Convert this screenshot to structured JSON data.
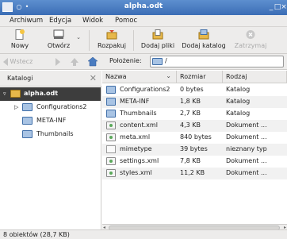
{
  "window": {
    "title": "alpha.odt"
  },
  "menu": [
    {
      "label": "Archiwum"
    },
    {
      "label": "Edycja"
    },
    {
      "label": "Widok"
    },
    {
      "label": "Pomoc"
    }
  ],
  "toolbar": {
    "new": "Nowy",
    "open": "Otwórz",
    "extract": "Rozpakuj",
    "add_files": "Dodaj pliki",
    "add_folder": "Dodaj katalog",
    "stop": "Zatrzymaj"
  },
  "location": {
    "back": "Wstecz",
    "label": "Położenie:",
    "path": "/"
  },
  "sidebar": {
    "title": "Katalogi",
    "root": "alpha.odt",
    "items": [
      "Configurations2",
      "META-INF",
      "Thumbnails"
    ]
  },
  "columns": {
    "name": "Nazwa",
    "size": "Rozmiar",
    "type": "Rodzaj"
  },
  "files": [
    {
      "name": "Configurations2",
      "size": "0 bytes",
      "type": "Katalog",
      "icon": "folder-icon"
    },
    {
      "name": "META-INF",
      "size": "1,8 KB",
      "type": "Katalog",
      "icon": "folder-icon"
    },
    {
      "name": "Thumbnails",
      "size": "2,7 KB",
      "type": "Katalog",
      "icon": "folder-icon"
    },
    {
      "name": "content.xml",
      "size": "4,3 KB",
      "type": "Dokument ...",
      "icon": "xml-file-icon"
    },
    {
      "name": "meta.xml",
      "size": "840 bytes",
      "type": "Dokument ...",
      "icon": "xml-file-icon"
    },
    {
      "name": "mimetype",
      "size": "39 bytes",
      "type": "nieznany typ",
      "icon": "file-icon"
    },
    {
      "name": "settings.xml",
      "size": "7,8 KB",
      "type": "Dokument ...",
      "icon": "xml-file-icon"
    },
    {
      "name": "styles.xml",
      "size": "11,2 KB",
      "type": "Dokument ...",
      "icon": "xml-file-icon"
    }
  ],
  "status": "8 obiektów (28,7 KB)"
}
